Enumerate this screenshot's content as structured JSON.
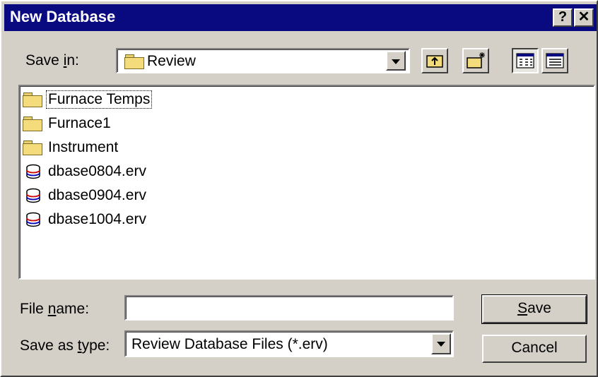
{
  "window": {
    "title": "New Database",
    "help_label": "?",
    "close_label": "✕"
  },
  "save_in": {
    "label_pre": "Save ",
    "label_key": "i",
    "label_post": "n:",
    "value": "Review"
  },
  "files": [
    {
      "name": "Furnace Temps",
      "type": "folder"
    },
    {
      "name": "Furnace1",
      "type": "folder"
    },
    {
      "name": "Instrument",
      "type": "folder"
    },
    {
      "name": "dbase0804.erv",
      "type": "database"
    },
    {
      "name": "dbase0904.erv",
      "type": "database"
    },
    {
      "name": "dbase1004.erv",
      "type": "database"
    }
  ],
  "file_name": {
    "label_pre": "File ",
    "label_key": "n",
    "label_post": "ame:",
    "value": ""
  },
  "save_as_type": {
    "label_pre": "Save as ",
    "label_key": "t",
    "label_post": "ype:",
    "value": "Review Database Files (*.erv)"
  },
  "buttons": {
    "save_key": "S",
    "save_rest": "ave",
    "cancel": "Cancel"
  },
  "icons": {
    "toolbar": [
      "up-one-level-icon",
      "create-new-folder-icon",
      "list-view-icon",
      "details-view-icon"
    ]
  },
  "colors": {
    "titlebar": "#0a0a80",
    "face": "#d4d0c8",
    "folder": "#f4dc7c"
  }
}
